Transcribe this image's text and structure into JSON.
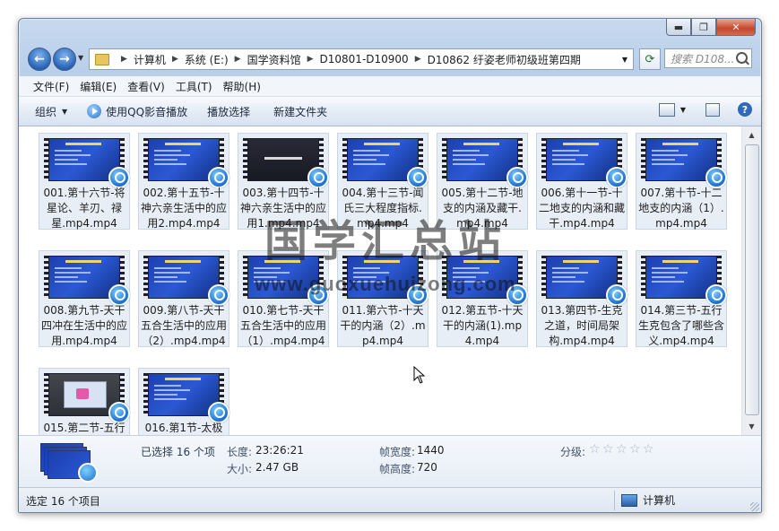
{
  "window": {
    "buttons": {
      "minimize": "▬",
      "maximize": "❐",
      "close": "✕"
    }
  },
  "nav": {
    "back_icon": "back-arrow-icon",
    "forward_icon": "forward-arrow-icon"
  },
  "address": {
    "crumbs": [
      "计算机",
      "系统 (E:)",
      "国学资料馆",
      "D10801-D10900",
      "D10862 纡姿老师初级班第四期"
    ]
  },
  "search": {
    "placeholder": "搜索 D108..."
  },
  "menu": [
    "文件(F)",
    "编辑(E)",
    "查看(V)",
    "工具(T)",
    "帮助(H)"
  ],
  "toolbar": {
    "organize": "组织",
    "play_qq": "使用QQ影音播放",
    "play_selection": "播放选择",
    "new_folder": "新建文件夹",
    "help": "?"
  },
  "files": [
    {
      "name": "001.第十六节-将星论、羊刃、禄星.mp4.mp4",
      "thumb": "blue"
    },
    {
      "name": "002.第十五节-十神六亲生活中的应用2.mp4.mp4",
      "thumb": "blue"
    },
    {
      "name": "003.第十四节-十神六亲生活中的应用1.mp4.mp4",
      "thumb": "dark"
    },
    {
      "name": "004.第十三节-闻氏三大程度指标.mp4.mp4",
      "thumb": "blue"
    },
    {
      "name": "005.第十二节-地支的内涵及藏干.mp4.mp4",
      "thumb": "blue"
    },
    {
      "name": "006.第十一节-十二地支的内涵和藏干.mp4.mp4",
      "thumb": "blue"
    },
    {
      "name": "007.第十节-十二地支的内涵（1）.mp4.mp4",
      "thumb": "blue"
    },
    {
      "name": "008.第九节-天干四冲在生活中的应用.mp4.mp4",
      "thumb": "blue"
    },
    {
      "name": "009.第八节-天干五合生活中的应用（2）.mp4.mp4",
      "thumb": "blue"
    },
    {
      "name": "010.第七节-天干五合生活中的应用（1）.mp4.mp4",
      "thumb": "blue"
    },
    {
      "name": "011.第六节-十天干的内涵（2）.mp4.mp4",
      "thumb": "blue"
    },
    {
      "name": "012.第五节-十天干的内涵(1).mp4.mp4",
      "thumb": "blue"
    },
    {
      "name": "013.第四节-生克之道，时间局架构.mp4.mp4",
      "thumb": "blue"
    },
    {
      "name": "014.第三节-五行生克包含了哪些含义.mp4.mp4",
      "thumb": "blue"
    },
    {
      "name": "015.第二节-五行",
      "thumb": "room"
    },
    {
      "name": "016.第1节-太极",
      "thumb": "blue"
    }
  ],
  "details": {
    "selected": "已选择 16 个项",
    "length_label": "长度:",
    "length_value": "23:26:21",
    "size_label": "大小:",
    "size_value": "2.47 GB",
    "frame_width_label": "帧宽度:",
    "frame_width_value": "1440",
    "frame_height_label": "帧高度:",
    "frame_height_value": "720",
    "rating_label": "分级:",
    "rating_stars": 0
  },
  "status": {
    "left": "选定 16 个项目",
    "right": "计算机"
  },
  "watermark": {
    "title": "国学汇总站",
    "url": "www.guoxuehuizong.com"
  }
}
